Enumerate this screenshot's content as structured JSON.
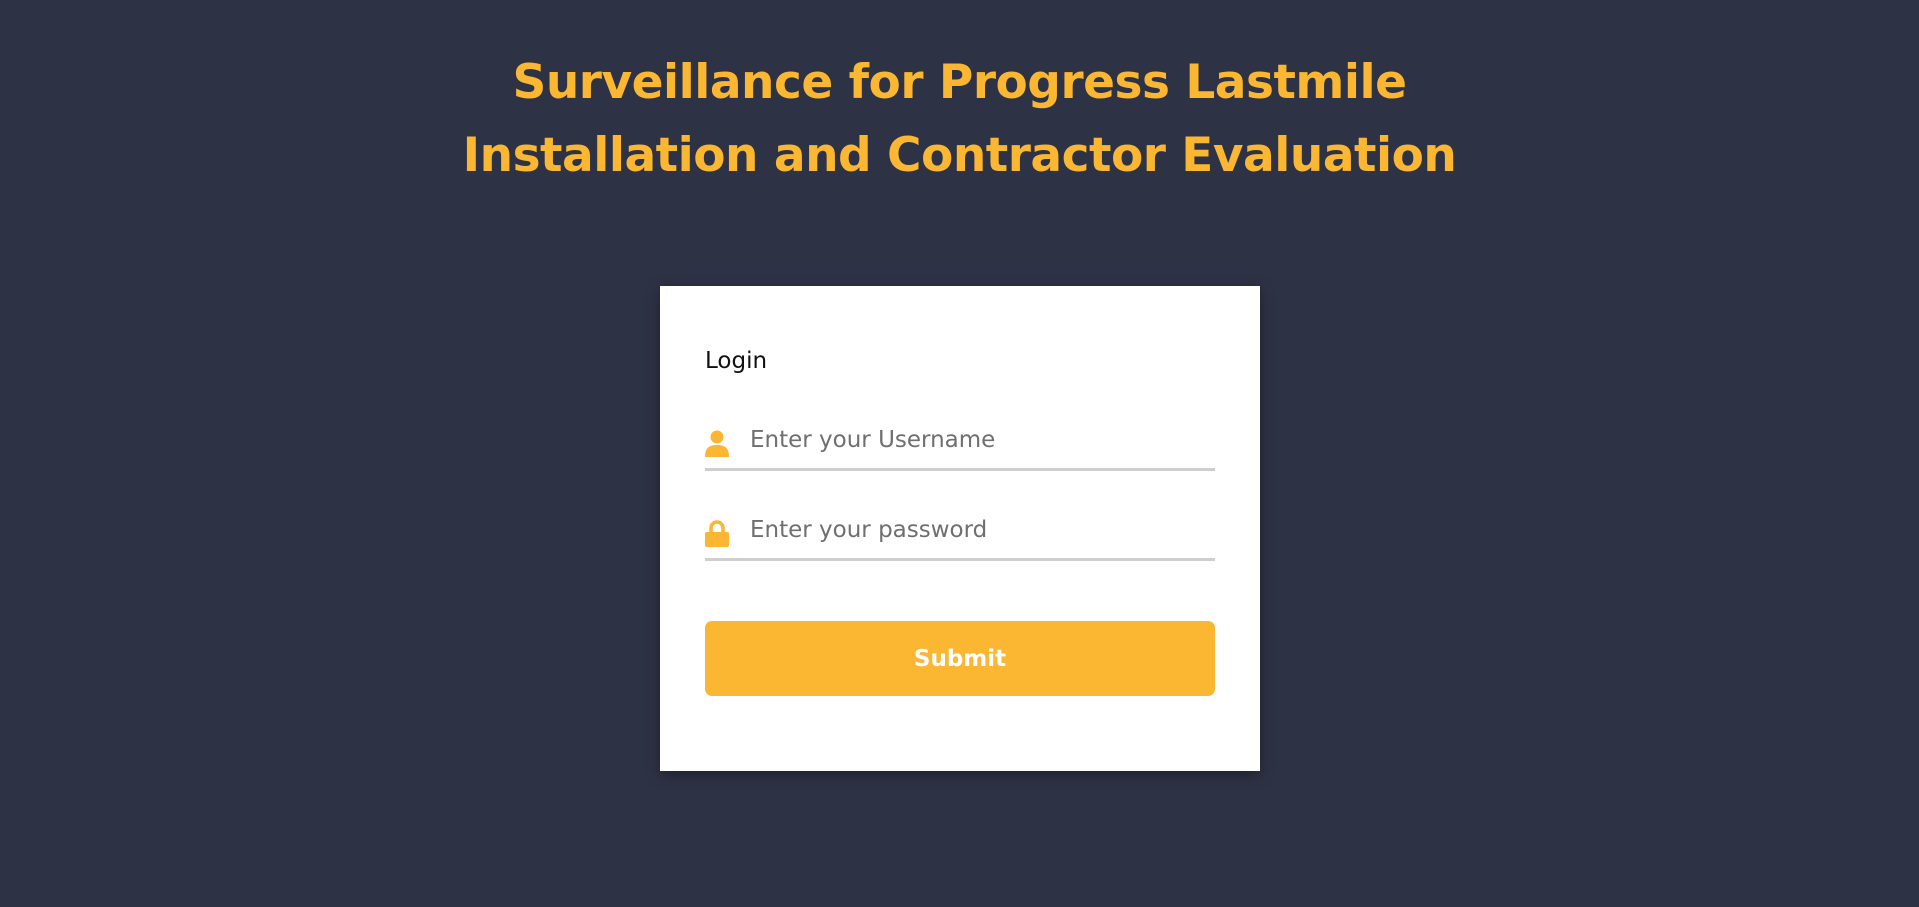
{
  "page": {
    "title_line1": "Surveillance for Progress Lastmile",
    "title_line2": "Installation and Contractor Evaluation"
  },
  "login_form": {
    "heading": "Login",
    "username": {
      "placeholder": "Enter your Username",
      "value": "",
      "icon": "user-icon"
    },
    "password": {
      "placeholder": "Enter your password",
      "value": "",
      "icon": "lock-icon"
    },
    "submit_label": "Submit"
  },
  "colors": {
    "background": "#2e3245",
    "accent": "#fbb632",
    "card": "#ffffff",
    "field_underline": "#cfcfcf"
  }
}
